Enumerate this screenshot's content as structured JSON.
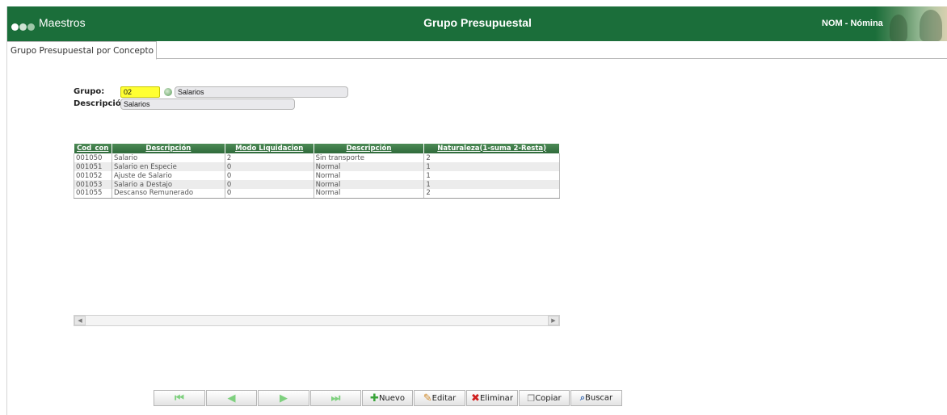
{
  "header": {
    "module": "Maestros",
    "title": "Grupo Presupuestal",
    "app": "NOM - Nómina",
    "dot_colors": [
      "#ffffff",
      "#cfe3d3",
      "#9fc7a9"
    ]
  },
  "tabs": [
    {
      "label": "Grupo Presupuestal por Concepto",
      "active": true
    }
  ],
  "form": {
    "grupo_label": "Grupo:",
    "grupo_code": "02",
    "grupo_name": "Salarios",
    "descripcion_label": "Descripción:",
    "descripcion_value": "Salarios"
  },
  "grid": {
    "columns": [
      "Cod_con",
      "Descripción",
      "Modo Liquidacion",
      "Descripción",
      "Naturaleza(1-suma 2-Resta)"
    ],
    "rows": [
      [
        "001050",
        "Salario",
        "2",
        "Sin transporte",
        "2"
      ],
      [
        "001051",
        "Salario en Especie",
        "0",
        "Normal",
        "1"
      ],
      [
        "001052",
        "Ajuste de Salario",
        "0",
        "Normal",
        "1"
      ],
      [
        "001053",
        "Salario a Destajo",
        "0",
        "Normal",
        "1"
      ],
      [
        "001055",
        "Descanso Remunerado",
        "0",
        "Normal",
        "2"
      ]
    ]
  },
  "toolbar": {
    "first_icon": "first-record-icon",
    "prev_icon": "previous-record-icon",
    "next_icon": "next-record-icon",
    "last_icon": "last-record-icon",
    "nuevo": "Nuevo",
    "editar": "Editar",
    "eliminar": "Eliminar",
    "copiar": "Copiar",
    "buscar": "Buscar"
  },
  "colors": {
    "header_bg": "#1b6e3a",
    "grid_header": "#3f7d49",
    "highlight_field": "#ffff33"
  }
}
